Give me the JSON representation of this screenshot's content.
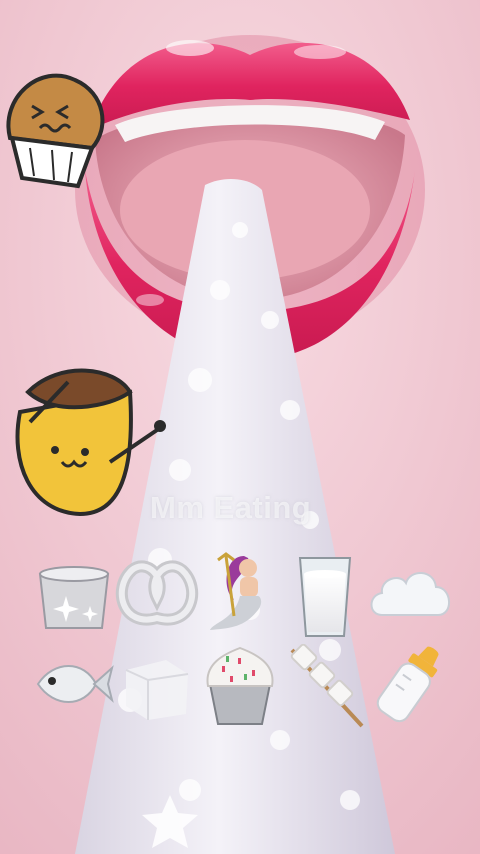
{
  "watermark": {
    "text": "Mm Eating"
  },
  "stickers": {
    "top": [
      {
        "name": "dizzy-muffin-sticker-icon"
      },
      {
        "name": "pudding-drumming-sticker-icon"
      }
    ]
  },
  "items_row1": [
    {
      "name": "sparkle-pot-icon"
    },
    {
      "name": "pretzel-icon"
    },
    {
      "name": "mermaid-icon"
    },
    {
      "name": "milk-glass-icon"
    },
    {
      "name": "cloud-icon"
    }
  ],
  "items_row2": [
    {
      "name": "fish-icon"
    },
    {
      "name": "white-cube-icon"
    },
    {
      "name": "cupcake-icon"
    },
    {
      "name": "marshmallow-skewer-icon"
    },
    {
      "name": "baby-bottle-icon"
    }
  ],
  "colors": {
    "lips": "#e8306a",
    "background": "#f2c9d3",
    "tongue": "#e9a6b3",
    "cone": "#e6e4ee"
  }
}
